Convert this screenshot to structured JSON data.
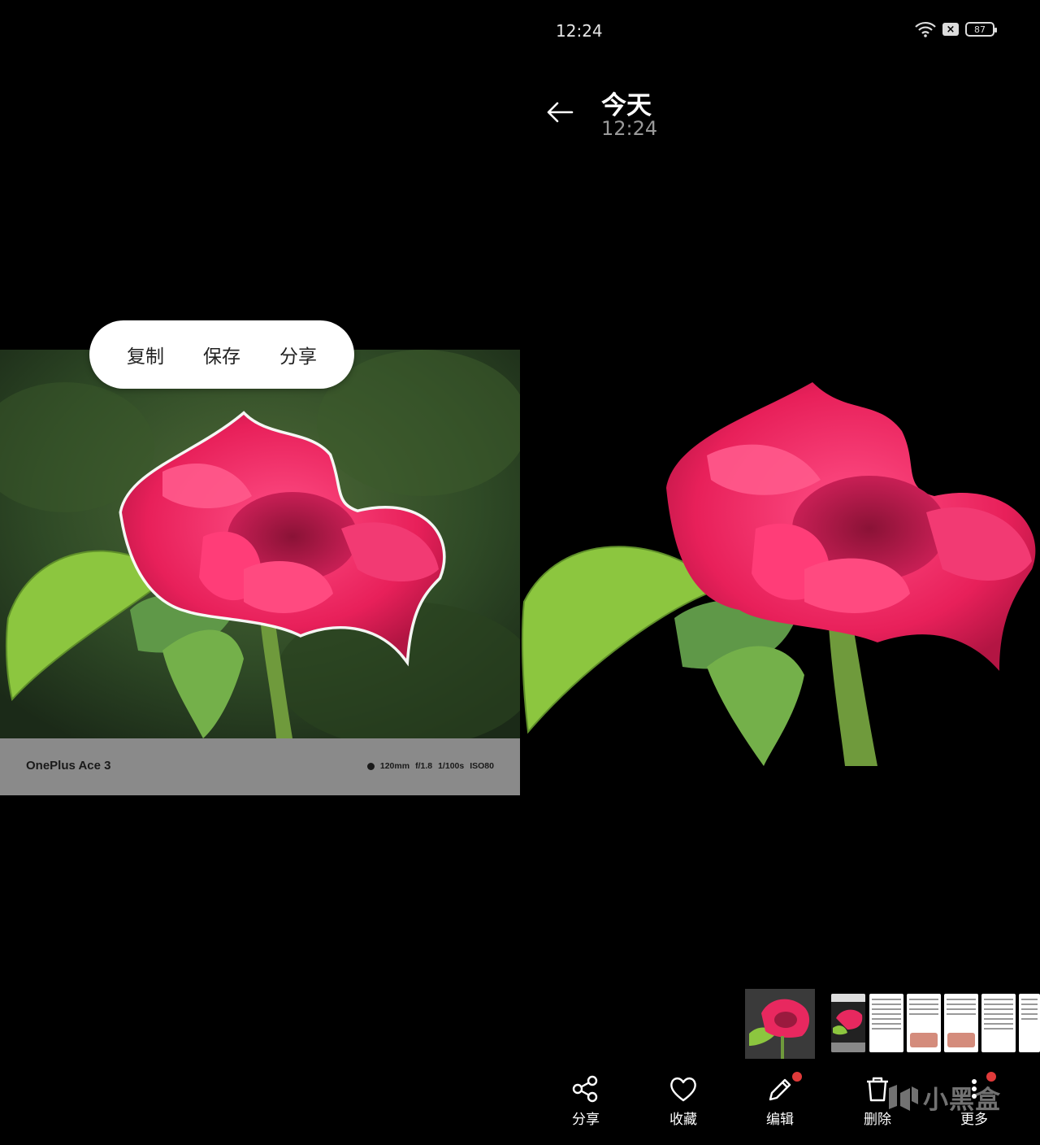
{
  "status_bar": {
    "time": "12:24",
    "battery": "87",
    "sim_badge": "×"
  },
  "header": {
    "title": "今天",
    "subtitle": "12:24"
  },
  "popup_menu": {
    "items": [
      "复制",
      "保存",
      "分享"
    ]
  },
  "photo_watermark": {
    "model": "OnePlus Ace 3",
    "params": [
      "120mm",
      "f/1.8",
      "1/100s",
      "ISO80"
    ]
  },
  "toolbar": {
    "items": [
      {
        "label": "分享",
        "icon": "share-icon",
        "badge": false
      },
      {
        "label": "收藏",
        "icon": "heart-icon",
        "badge": false
      },
      {
        "label": "编辑",
        "icon": "pencil-icon",
        "badge": true
      },
      {
        "label": "删除",
        "icon": "trash-icon",
        "badge": false
      },
      {
        "label": "更多",
        "icon": "more-icon",
        "badge": true
      }
    ]
  },
  "brand_watermark": "小黑盒",
  "colors": {
    "badge": "#e03a3a",
    "popup_bg": "#ffffff",
    "flower": "#e8285f",
    "leaf": "#8cc63f"
  }
}
